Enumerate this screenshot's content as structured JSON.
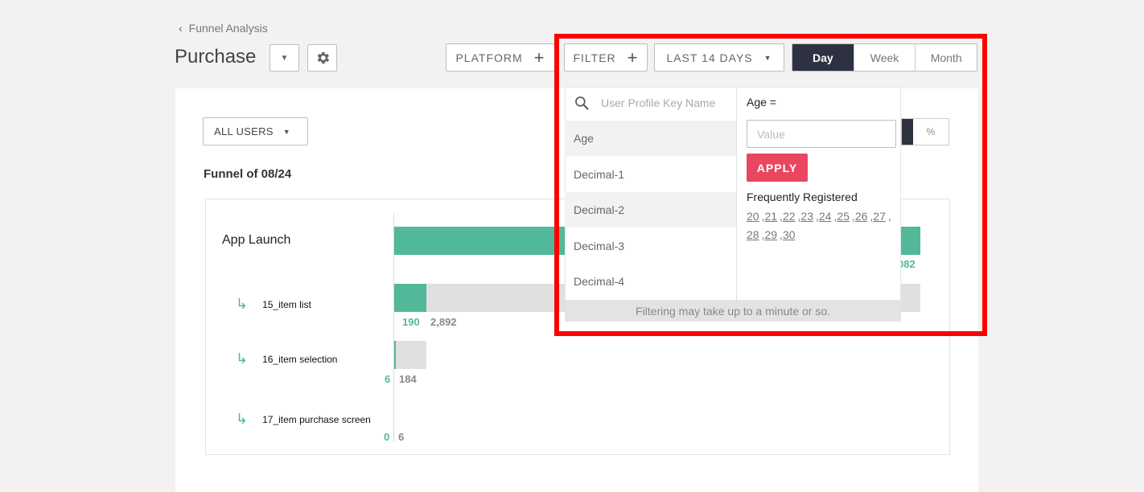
{
  "breadcrumb": {
    "label": "Funnel Analysis"
  },
  "header": {
    "title": "Purchase"
  },
  "toolbar": {
    "platform_label": "PLATFORM",
    "filter_label": "FILTER",
    "date_range_label": "LAST 14 DAYS",
    "period": {
      "day": "Day",
      "week": "Week",
      "month": "Month",
      "selected": "Day"
    }
  },
  "segment": {
    "label": "ALL USERS"
  },
  "funnel": {
    "title": "Funnel of 08/24",
    "steps": [
      {
        "label": "App Launch",
        "value_hidden_partial": "082"
      },
      {
        "label": "15_item list",
        "converted": "190",
        "total": "2,892"
      },
      {
        "label": "16_item selection",
        "converted": "6",
        "total": "184"
      },
      {
        "label": "17_item purchase screen",
        "converted": "0",
        "total": "6"
      }
    ]
  },
  "filter_dropdown": {
    "search_placeholder": "User Profile Key Name",
    "keys": [
      "Age",
      "Decimal-1",
      "Decimal-2",
      "Decimal-3",
      "Decimal-4"
    ],
    "selected_key": "Age",
    "condition_label": "Age =",
    "value_placeholder": "Value",
    "percent_label": "%",
    "apply_label": "APPLY",
    "frequent_title": "Frequently Registered",
    "frequent_values": [
      "20",
      "21",
      "22",
      "23",
      "24",
      "25",
      "26",
      "27",
      "28",
      "29",
      "30"
    ],
    "footer_note": "Filtering may take up to a minute or so."
  },
  "colors": {
    "accent_green": "#52b89a",
    "apply_red": "#e9475f",
    "highlight_red": "#ff0000",
    "dark_navy": "#2e3140"
  }
}
